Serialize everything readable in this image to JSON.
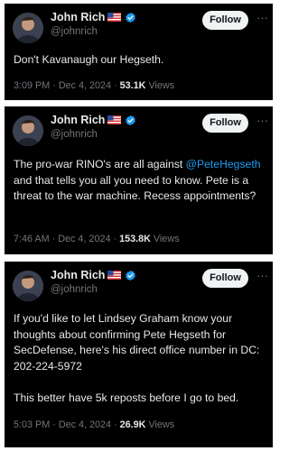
{
  "tweets": [
    {
      "author_name": "John Rich",
      "handle": "@johnrich",
      "follow_label": "Follow",
      "text": "Don't Kavanaugh our Hegseth.",
      "time": "3:09 PM",
      "date": "Dec 4, 2024",
      "views_count": "53.1K",
      "views_label": "Views"
    },
    {
      "author_name": "John Rich",
      "handle": "@johnrich",
      "follow_label": "Follow",
      "text_before": "The pro-war RINO's are all against ",
      "mention": "@PeteHegseth",
      "text_after": " and that tells you all you need to know. Pete is a threat to the war machine. Recess appointments?",
      "time": "7:46 AM",
      "date": "Dec 4, 2024",
      "views_count": "153.8K",
      "views_label": "Views"
    },
    {
      "author_name": "John Rich",
      "handle": "@johnrich",
      "follow_label": "Follow",
      "text": "If you'd like to let Lindsey Graham know your thoughts about confirming Pete Hegseth for SecDefense, here's his direct office number in DC: 202-224-5972\n\nThis better have 5k reposts before I go to bed.",
      "time": "5:03 PM",
      "date": "Dec 4, 2024",
      "views_count": "26.9K",
      "views_label": "Views"
    }
  ],
  "separator": "·",
  "icons": {
    "verified": "verified-badge-icon",
    "flag": "us-flag-icon",
    "more": "more-options-icon"
  },
  "colors": {
    "background": "#000000",
    "text": "#e7e9ea",
    "muted": "#71767b",
    "accent": "#1d9bf0",
    "follow_bg": "#eff3f4"
  }
}
